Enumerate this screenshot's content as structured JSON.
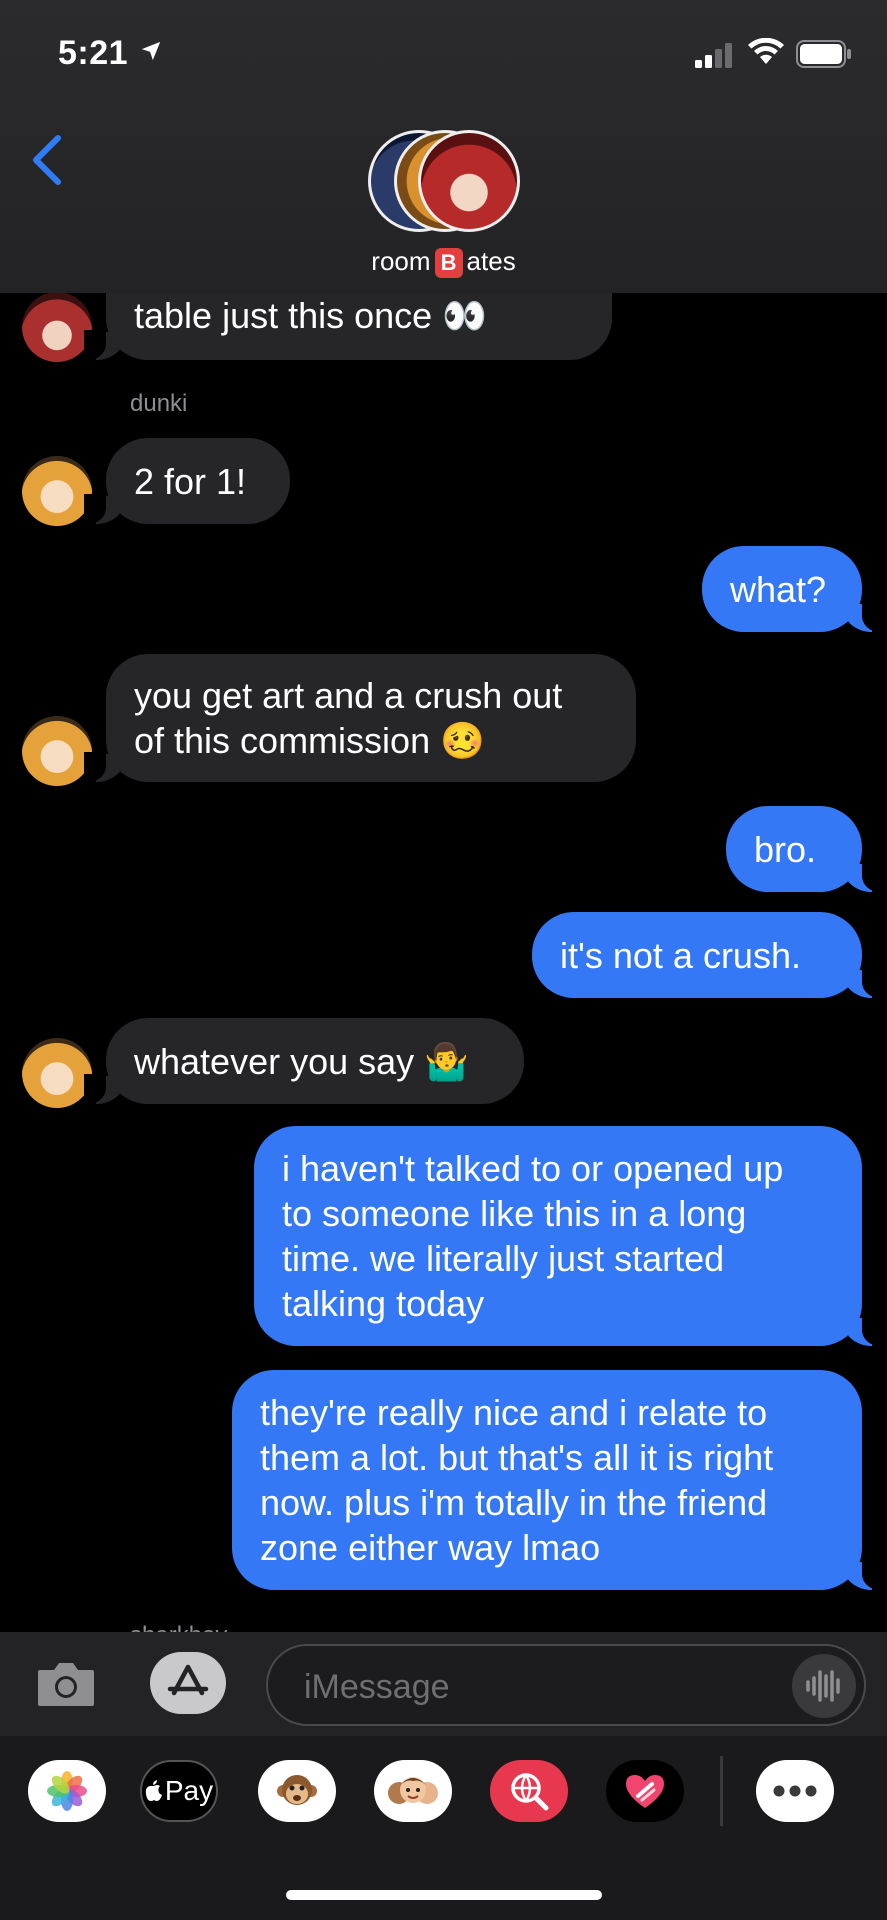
{
  "status_bar": {
    "time": "5:21"
  },
  "header": {
    "group_name_before": "room",
    "group_name_badge": "B",
    "group_name_after": "ates"
  },
  "messages": [
    {
      "id": "m0",
      "direction": "in",
      "text": "table just this once 👀"
    },
    {
      "id": "m1",
      "direction": "in",
      "sender": "dunki",
      "text": "2 for 1!"
    },
    {
      "id": "m2",
      "direction": "out",
      "text": "what?"
    },
    {
      "id": "m3",
      "direction": "in",
      "text": "you get art and a crush out\nof this commission 🥴"
    },
    {
      "id": "m4",
      "direction": "out",
      "text": "bro."
    },
    {
      "id": "m5",
      "direction": "out",
      "text": "it's not a crush."
    },
    {
      "id": "m6",
      "direction": "in",
      "text": "whatever you say 🤷‍♂️"
    },
    {
      "id": "m7",
      "direction": "out",
      "text": "i haven't talked to or opened up\nto someone like this in a long\ntime. we literally just started\ntalking today"
    },
    {
      "id": "m8",
      "direction": "out",
      "text": "they're really nice and i relate to\nthem a lot. but that's all it is right\nnow. plus i'm totally in the friend\nzone either way lmao"
    }
  ],
  "next_sender_partial": "sharkboy",
  "input": {
    "placeholder": "iMessage"
  },
  "app_drawer": {
    "items": [
      "photos",
      "apple-pay",
      "animoji",
      "memoji",
      "search-images",
      "digital-touch"
    ],
    "apple_pay_label": "Pay",
    "more": "more"
  },
  "colors": {
    "outgoing": "#3478f6",
    "incoming": "#262629",
    "header": "#2b2b2d",
    "accent": "#2f7cf6"
  }
}
